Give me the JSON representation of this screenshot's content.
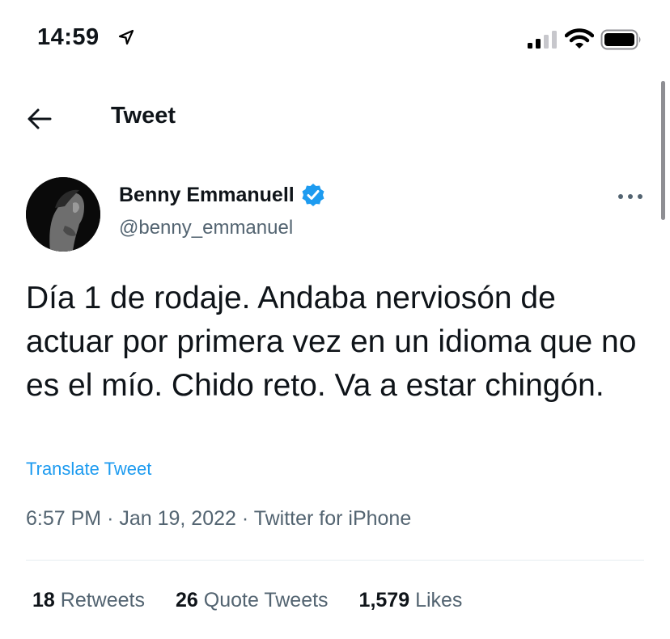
{
  "status_bar": {
    "time": "14:59",
    "icons": [
      "location-arrow-icon",
      "cellular-signal-icon",
      "wifi-icon",
      "battery-icon"
    ]
  },
  "header": {
    "back_icon": "back-arrow-icon",
    "title": "Tweet"
  },
  "tweet": {
    "author_name": "Benny Emmanuell",
    "verified": true,
    "handle": "@benny_emmanuel",
    "more_icon": "more-options-icon",
    "text": "Día 1 de rodaje. Andaba nerviosón de actuar por primera vez en un idioma que no es el mío. Chido reto. Va a estar chingón.",
    "translate_label": "Translate Tweet",
    "time": "6:57 PM",
    "separator": "·",
    "date": "Jan 19, 2022",
    "source": "Twitter for iPhone",
    "stats": {
      "retweets_count": "18",
      "retweets_label": "Retweets",
      "quotes_count": "26",
      "quotes_label": "Quote Tweets",
      "likes_count": "1,579",
      "likes_label": "Likes"
    }
  },
  "colors": {
    "accent": "#1d9bf0",
    "text": "#0f1419",
    "secondary": "#536471"
  }
}
